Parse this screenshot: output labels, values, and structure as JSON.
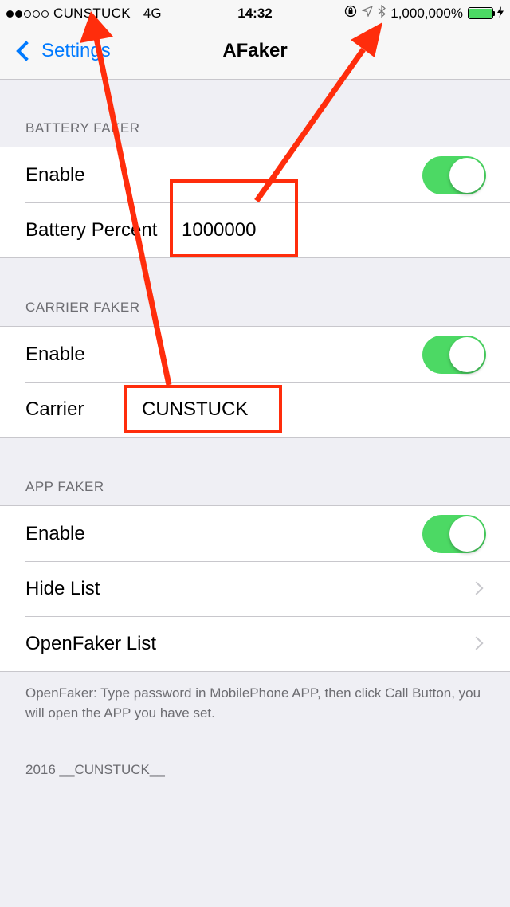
{
  "status_bar": {
    "signal": [
      true,
      true,
      false,
      false,
      false
    ],
    "carrier": "CUNSTUCK",
    "network": "4G",
    "time": "14:32",
    "battery_percent_text": "1,000,000%",
    "battery_level": 1.0,
    "icons": [
      "orientation-lock-icon",
      "location-icon",
      "bluetooth-icon",
      "charging-bolt-icon"
    ]
  },
  "nav": {
    "back_label": "Settings",
    "title": "AFaker"
  },
  "sections": {
    "battery": {
      "header": "BATTERY FAKER",
      "enable_label": "Enable",
      "enable_on": true,
      "percent_label": "Battery Percent",
      "percent_value": "1000000"
    },
    "carrier": {
      "header": "CARRIER FAKER",
      "enable_label": "Enable",
      "enable_on": true,
      "carrier_label": "Carrier",
      "carrier_value": "CUNSTUCK"
    },
    "app": {
      "header": "APP FAKER",
      "enable_label": "Enable",
      "enable_on": true,
      "hide_list_label": "Hide List",
      "openfaker_list_label": "OpenFaker List",
      "footer": "OpenFaker: Type password in MobilePhone APP, then click Call Button, you will open the APP you have set."
    }
  },
  "credit": "2016 __CUNSTUCK__",
  "colors": {
    "accent": "#007aff",
    "toggle_on": "#4cd964",
    "annotation": "#ff2d0c",
    "background": "#efeff4"
  }
}
